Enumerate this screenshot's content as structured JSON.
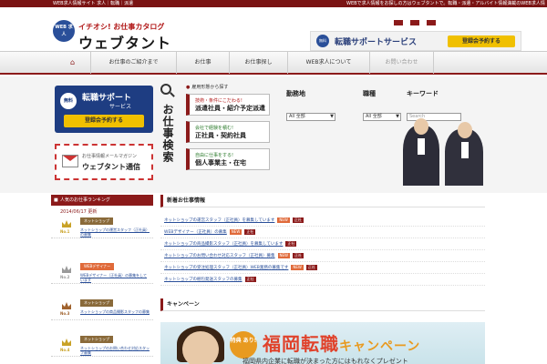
{
  "topstrip": {
    "left": "WEB求人情報サイト 求人｜転職｜派遣",
    "right": "WEBで求人情報をお探しの方はウェブタントで。転職・派遣・アルバイト情報満載のWEB求人情報サイト"
  },
  "header": {
    "logo_badge": "WEB 求人",
    "logo_sub": "イチオシ! お仕事カタログ",
    "logo_main": "ウェブタント",
    "banner_free": "無料",
    "banner_text": "転職サポートサービス",
    "banner_button": "登録会予約する"
  },
  "nav": {
    "items": [
      "お仕事のご紹介まで",
      "お仕事",
      "お仕事探し",
      "WEB求人について",
      "お問い合わせ"
    ]
  },
  "search": {
    "promo_free": "無料",
    "promo_title": "転職サポート",
    "promo_sub": "サービス",
    "promo_button": "登録会予約する",
    "mag_sub": "お仕事情報メールマガジン",
    "mag_title": "ウェブタント通信",
    "vertical_title": "お仕事検索",
    "categories_heading": "雇用形態から探す",
    "categories": [
      {
        "sub": "技術・条件にこだわる!",
        "main": "派遣社員・紹介予定派遣",
        "variant": "red"
      },
      {
        "sub": "会社で経験を積む!",
        "main": "正社員・契約社員",
        "variant": "green"
      },
      {
        "sub": "自由に仕事をする!",
        "main": "個人事業主・在宅",
        "variant": "green"
      }
    ],
    "filters": [
      {
        "label": "勤務地",
        "value": "All 全部"
      },
      {
        "label": "職種",
        "value": "All 全部"
      },
      {
        "label": "キーワード",
        "value": "Search"
      }
    ]
  },
  "sidebar": {
    "heading": "人気のお仕事ランキング",
    "date": "2014/06/17 更新",
    "items": [
      {
        "rank": "No.1",
        "tag": "ネットショップ",
        "text": "ネットショップの運営スタッフ（正社員）の募集",
        "color": "#c9a227"
      },
      {
        "rank": "No.2",
        "tag": "WEBデザイナー",
        "text": "WEBデザイナー（正社員）の募集をしています",
        "color": "#9a9a9a"
      },
      {
        "rank": "No.3",
        "tag": "ネットショップ",
        "text": "ネットショップの商品撮影スタッフの募集",
        "color": "#a0622d"
      },
      {
        "rank": "No.4",
        "tag": "ネットショップ",
        "text": "ネットショップのお問い合わせ対応スタッフ募集",
        "color": "#c9a227"
      }
    ]
  },
  "main": {
    "news_heading": "新着お仕事情報",
    "news": [
      {
        "text": "ネットショップの運営スタッフ（正社員）を募集しています",
        "new": "NEW",
        "kind": "正社"
      },
      {
        "text": "WEBデザイナー（正社員）の募集",
        "new": "NEW",
        "kind": "正社"
      },
      {
        "text": "ネットショップの商品撮影スタッフ（正社員）を募集しています",
        "new": "",
        "kind": "正社"
      },
      {
        "text": "ネットショップのお問い合わせ対応スタッフ（正社員）募集",
        "new": "NEW",
        "kind": "正社"
      },
      {
        "text": "ネットショップの受注処理スタッフ（正社員）WEB業務の募集です",
        "new": "NEW",
        "kind": "正社"
      },
      {
        "text": "ネットショップの梱包発送スタッフの募集",
        "new": "",
        "kind": "正社"
      }
    ],
    "campaign_heading": "キャンペーン",
    "campaign_badge": "特典 あり!",
    "campaign_title": "福岡転職",
    "campaign_title2": "キャンペーン",
    "campaign_sub": "福岡県内企業に転職が決まった方にはもれなくプレゼント"
  },
  "colors": {
    "accent": "#8b1a1a",
    "brand_blue": "#1e3d82",
    "cta_yellow": "#f0c000"
  }
}
